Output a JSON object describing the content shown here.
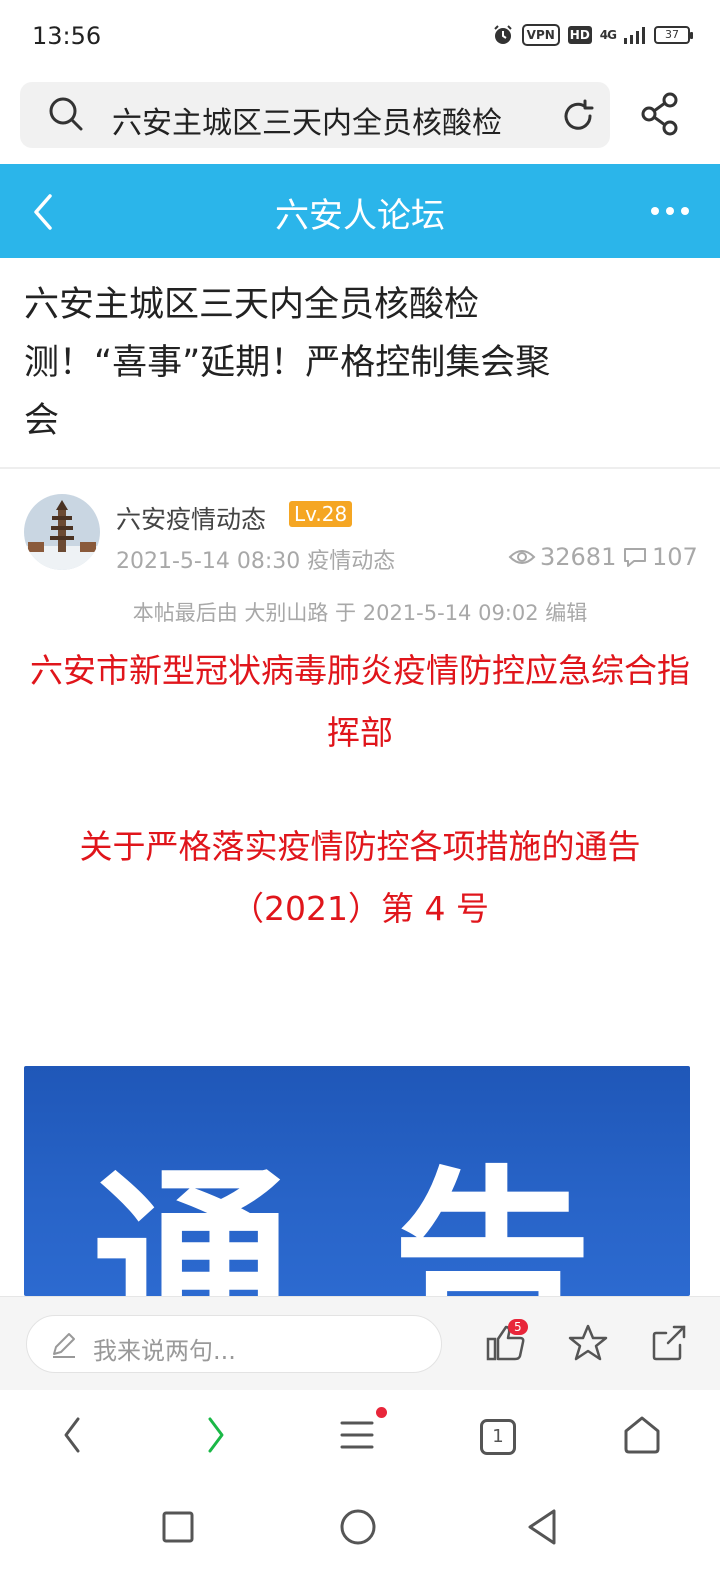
{
  "status_bar": {
    "time": "13:56",
    "vpn": "VPN",
    "hd": "HD",
    "network": "4G",
    "battery": "37"
  },
  "search": {
    "query": "六安主城区三天内全员核酸检"
  },
  "forum_header": {
    "title": "六安人论坛"
  },
  "post": {
    "title": "六安主城区三天内全员核酸检测！“喜事”延期！严格控制集会聚会",
    "author": "六安疫情动态",
    "level": "Lv.28",
    "meta": "2021-5-14 08:30 疫情动态",
    "views": "32681",
    "comments": "107",
    "edit_note": "本帖最后由 大别山路 于 2021-5-14 09:02 编辑",
    "body_heading_1": "六安市新型冠状病毒肺炎疫情防控应急综合指挥部",
    "body_heading_2": "关于严格落实疫情防控各项措施的通告（2021）第 4 号",
    "image_text_1": "通",
    "image_text_2": "告"
  },
  "comment_bar": {
    "placeholder": "我来说两句...",
    "like_count": "5"
  },
  "browser_nav": {
    "tabs_count": "1"
  },
  "colors": {
    "header_blue": "#2bb5ea",
    "alert_red": "#e0151b",
    "level_orange": "#f5a623",
    "forward_green": "#1bb847"
  }
}
